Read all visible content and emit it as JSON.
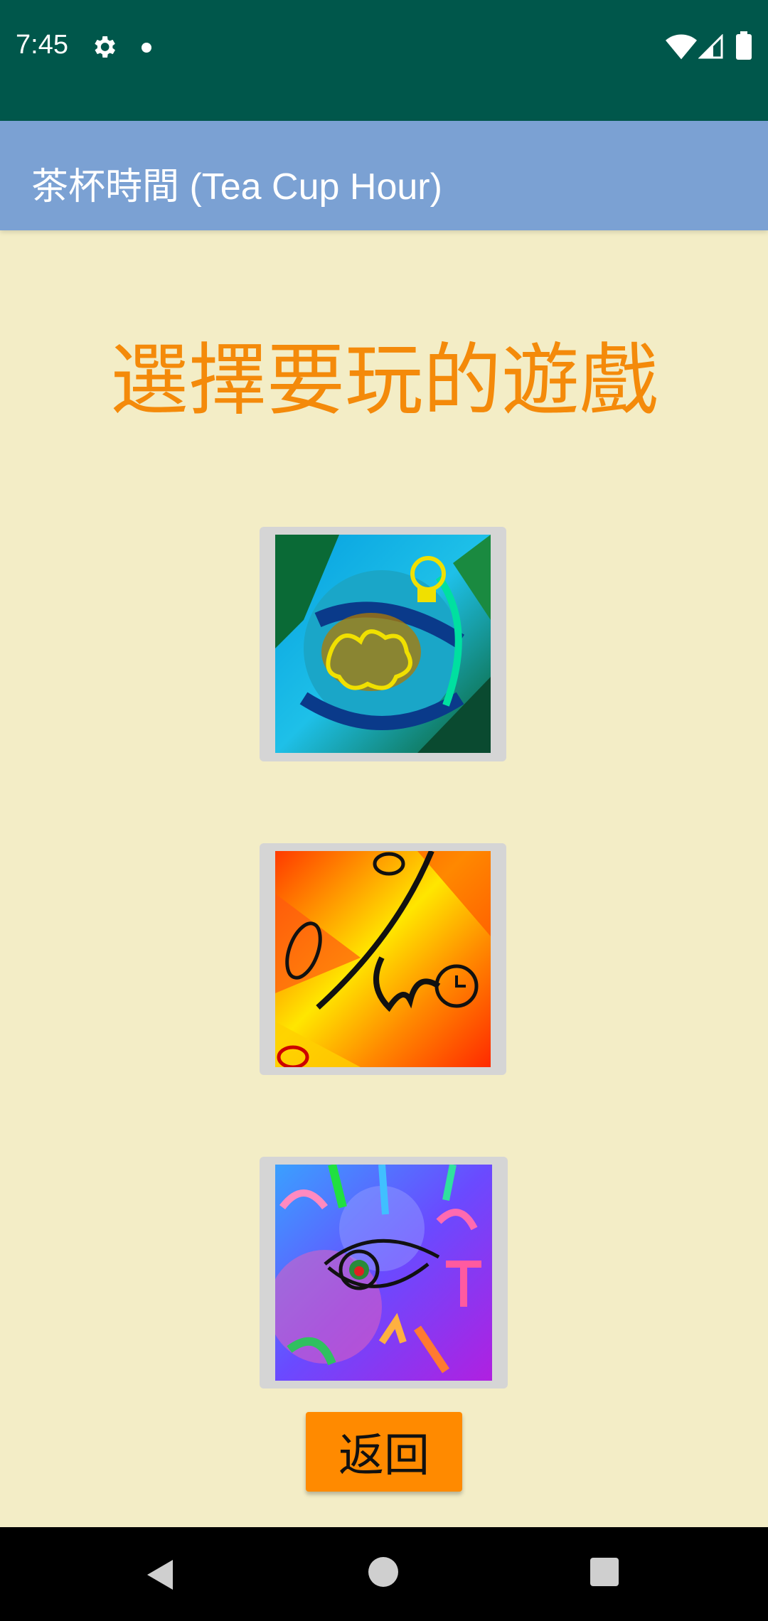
{
  "status_bar": {
    "time": "7:45",
    "icons": [
      "gear-icon",
      "notification-dot-icon",
      "wifi-icon",
      "signal-icon",
      "battery-icon"
    ]
  },
  "app_bar": {
    "title": "茶杯時間 (Tea Cup Hour)",
    "color": "#7BA1D3"
  },
  "main": {
    "headline": "選擇要玩的遊戲",
    "headline_color": "#F48A0A",
    "background": "#F3EDC6",
    "games": [
      {
        "icon": "brain-lightbulb-ornament-icon"
      },
      {
        "icon": "clocks-and-ink-brush-icon"
      },
      {
        "icon": "eye-and-letters-icon"
      }
    ],
    "back_button_label": "返回",
    "back_button_color": "#FF8A00"
  },
  "nav_bar": {
    "icons": [
      "nav-back-icon",
      "nav-home-icon",
      "nav-recents-icon"
    ]
  }
}
